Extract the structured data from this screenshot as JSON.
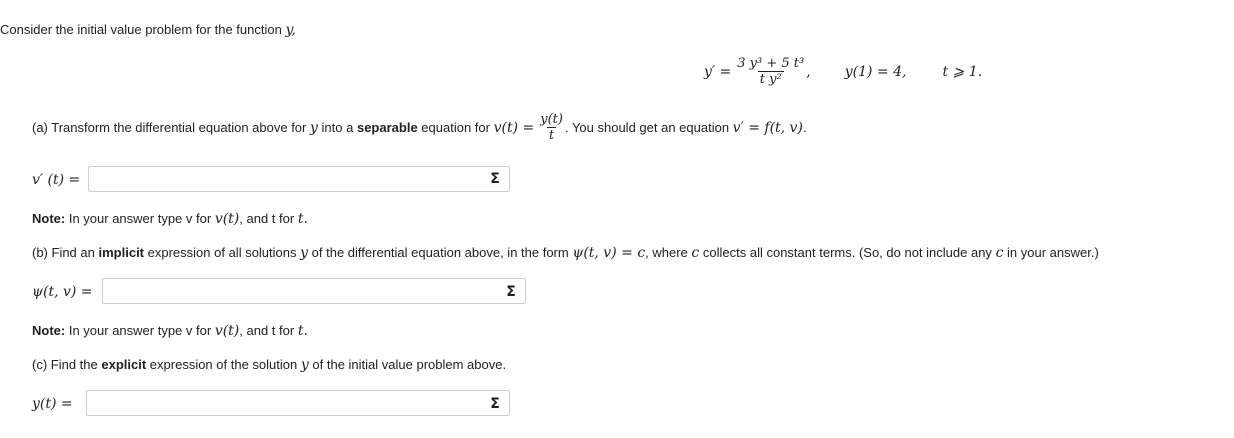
{
  "intro": "Consider the initial value problem for the function",
  "intro_var": "y,",
  "equation": {
    "lhs": "y′ =",
    "num": "3 y³ + 5 t³",
    "den": "t y²",
    "comma": ",",
    "ic": "y(1) = 4,",
    "domain": "t ⩾ 1."
  },
  "part_a": {
    "text1": "(a) Transform the differential equation above for",
    "var_y": "y",
    "text2": "into a",
    "bold": "separable",
    "text3": "equation for",
    "vt": "v(t) =",
    "num": "y(t)",
    "den": "t",
    "text4": ". You should get an equation",
    "eq": "v′ = f(t, v)",
    "end": ".",
    "label": "v′ (t) =",
    "value": "",
    "note_bold": "Note:",
    "note_text1": "In your answer type v for",
    "note_v": "v(t)",
    "note_text2": ", and t for",
    "note_t": "t."
  },
  "part_b": {
    "text1": "(b) Find an",
    "bold": "implicit",
    "text2": "expression of all solutions",
    "var_y": "y",
    "text3": "of the differential equation above, in the form",
    "psi": "ψ(t, v) = c",
    "text4": ", where",
    "c": "c",
    "text5": "collects all constant terms. (So, do not include any",
    "c2": "c",
    "text6": "in your answer.)",
    "label": "ψ(t, v) =",
    "value": "",
    "note_bold": "Note:",
    "note_text1": "In your answer type v for",
    "note_v": "v(t)",
    "note_text2": ", and t for",
    "note_t": "t."
  },
  "part_c": {
    "text1": "(c) Find the",
    "bold": "explicit",
    "text2": "expression of the solution",
    "var_y": "y",
    "text3": "of the initial value problem above.",
    "label": "y(t) =",
    "value": ""
  },
  "sigma_symbol": "Σ"
}
